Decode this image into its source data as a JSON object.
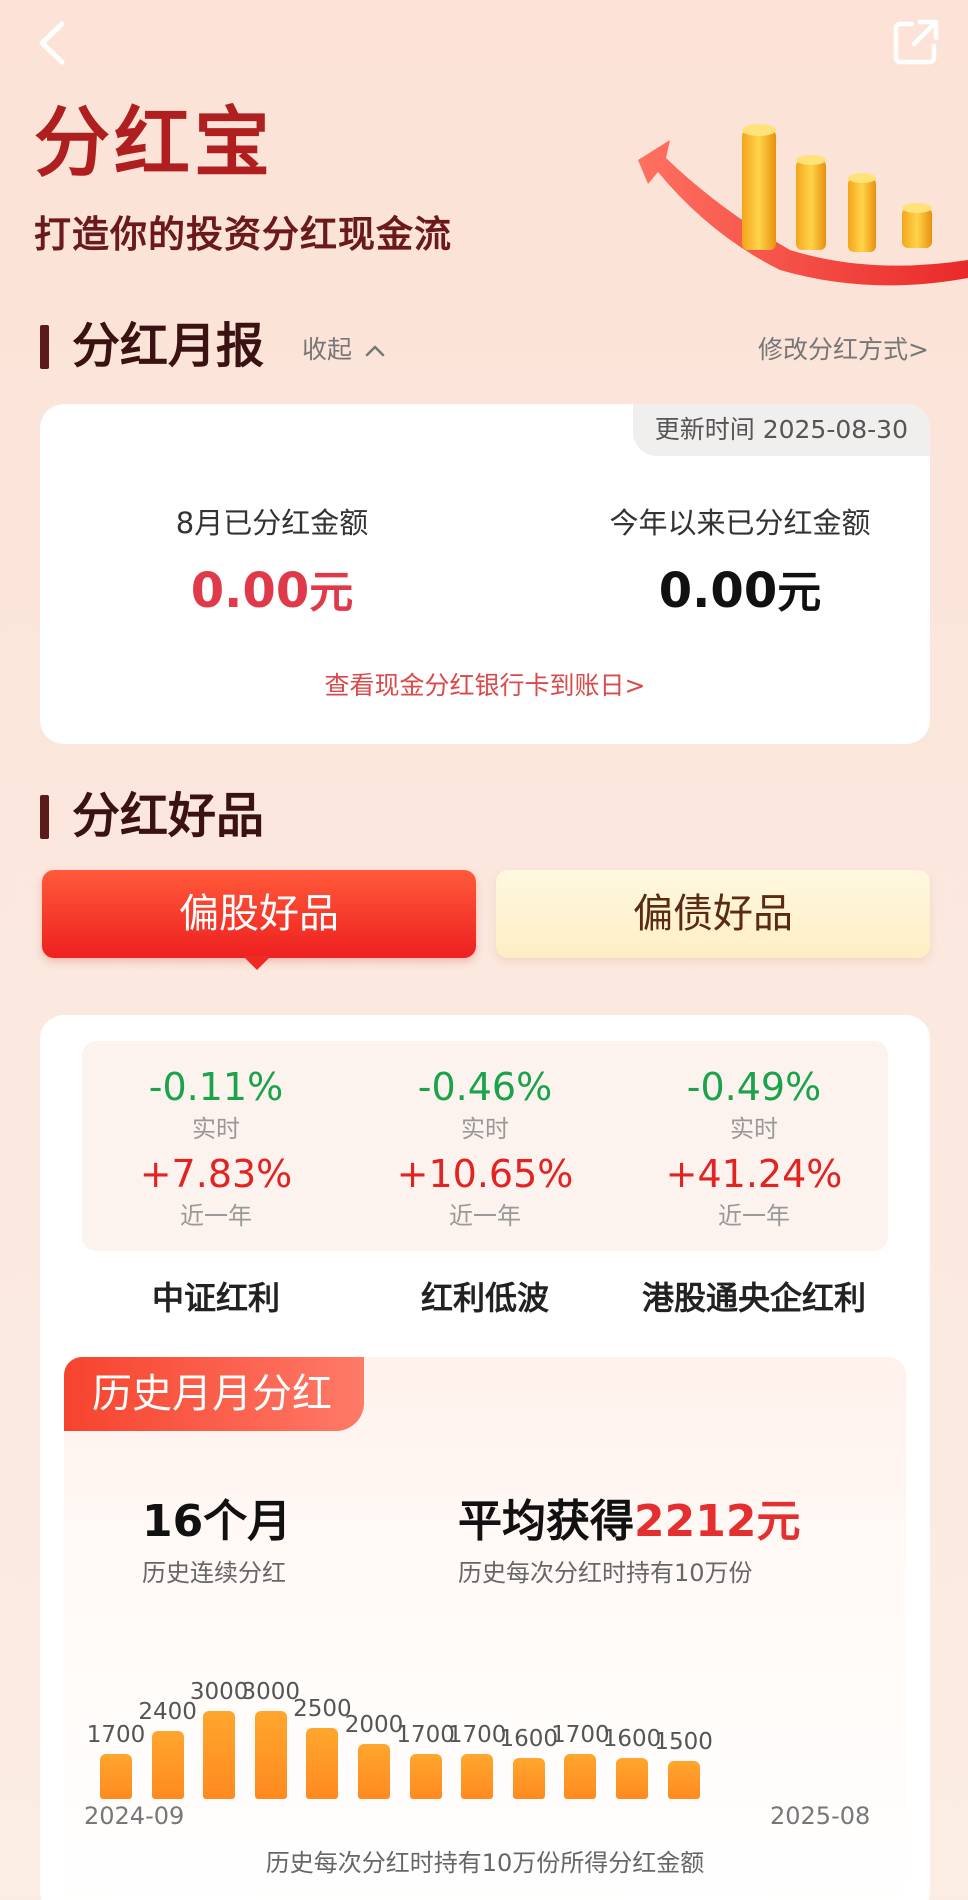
{
  "page": {
    "title": "分红宝",
    "subtitle": "打造你的投资分红现金流"
  },
  "report": {
    "section_title": "分红月报",
    "collapse_label": "收起",
    "modify_link": "修改分红方式>",
    "update_time": "更新时间 2025-08-30",
    "month_label": "8月已分红金额",
    "month_value": "0.00",
    "year_label": "今年以来已分红金额",
    "year_value": "0.00",
    "unit": "元",
    "bank_link": "查看现金分红银行卡到账日>"
  },
  "products": {
    "section_title": "分红好品",
    "tabs": [
      {
        "label": "偏股好品",
        "active": true
      },
      {
        "label": "偏债好品",
        "active": false
      }
    ],
    "realtime_caption": "实时",
    "year_caption": "近一年",
    "indices": [
      {
        "name": "中证红利",
        "realtime": "-0.11%",
        "one_year": "+7.83%"
      },
      {
        "name": "红利低波",
        "realtime": "-0.46%",
        "one_year": "+10.65%"
      },
      {
        "name": "港股通央企红利",
        "realtime": "-0.49%",
        "one_year": "+41.24%"
      }
    ]
  },
  "history": {
    "tag": "历史月月分红",
    "months_value": "16个月",
    "months_caption": "历史连续分红",
    "avg_prefix": "平均获得",
    "avg_value": "2212元",
    "avg_caption": "历史每次分红时持有10万份",
    "start_date": "2024-09",
    "end_date": "2025-08",
    "chart_caption": "历史每次分红时持有10万份所得分红金额"
  },
  "chart_data": {
    "type": "bar",
    "categories": [
      "2024-09",
      "",
      "",
      "",
      "",
      "",
      "",
      "",
      "",
      "",
      "",
      "2025-08"
    ],
    "values": [
      1700,
      2400,
      3000,
      3000,
      2500,
      2000,
      1700,
      1700,
      1600,
      1700,
      1600,
      1500
    ],
    "title": "",
    "xlabel": "",
    "ylabel": "",
    "colors": {
      "bar": "#ff9a28"
    }
  },
  "colors": {
    "brand_red": "#e32f2f",
    "title_red": "#b01f1f",
    "up_red": "#e32222",
    "down_green": "#1aa34a"
  },
  "icons": {
    "back": "chevron-left-icon",
    "share": "share-icon",
    "collapse": "chevron-up-icon"
  }
}
